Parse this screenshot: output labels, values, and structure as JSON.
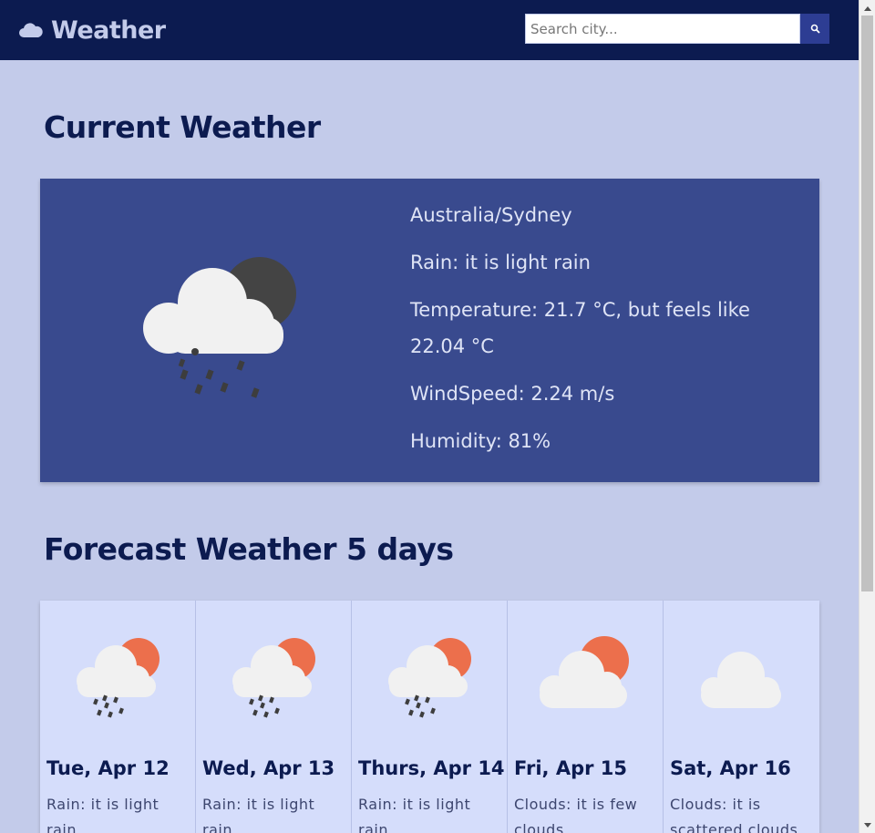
{
  "app": {
    "brand": "Weather",
    "search_placeholder": "Search city..."
  },
  "current": {
    "section_title": "Current Weather",
    "location": "Australia/Sydney",
    "condition": "Rain: it is light rain",
    "temperature_line1": "Temperature: 21.7 °C, but feels like",
    "temperature_line2": "22.04 °C",
    "wind": "WindSpeed: 2.24 m/s",
    "humidity": "Humidity: 81%",
    "icon": "rain-cloud-night-icon"
  },
  "forecast": {
    "section_title": "Forecast Weather 5 days",
    "days": [
      {
        "date": "Tue, Apr 12",
        "desc": "Rain: it is light rain",
        "icon": "rain-cloud-sun-icon"
      },
      {
        "date": "Wed, Apr 13",
        "desc": "Rain: it is light rain",
        "icon": "rain-cloud-sun-icon"
      },
      {
        "date": "Thurs, Apr 14",
        "desc": "Rain: it is light rain",
        "icon": "rain-cloud-sun-icon"
      },
      {
        "date": "Fri, Apr 15",
        "desc": "Clouds: it is few clouds",
        "icon": "cloud-sun-icon"
      },
      {
        "date": "Sat, Apr 16",
        "desc": "Clouds: it is scattered clouds",
        "icon": "cloud-icon"
      }
    ]
  },
  "colors": {
    "navbar": "#0c1b50",
    "page_bg": "#c3cbea",
    "current_card": "#394a8e",
    "forecast_card": "#d5ddfb",
    "sun": "#ec6f4c",
    "moon": "#444444"
  }
}
